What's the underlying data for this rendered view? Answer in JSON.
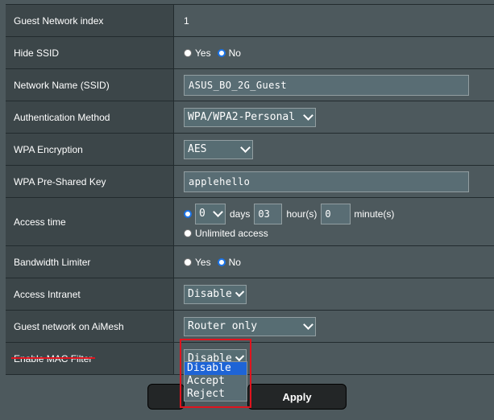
{
  "rows": {
    "guest_index": {
      "label": "Guest Network index",
      "value": "1"
    },
    "hide_ssid": {
      "label": "Hide SSID",
      "yes": "Yes",
      "no": "No"
    },
    "ssid": {
      "label": "Network Name (SSID)",
      "value": "ASUS_BO_2G_Guest"
    },
    "auth": {
      "label": "Authentication Method",
      "value": "WPA/WPA2-Personal"
    },
    "wpa_enc": {
      "label": "WPA Encryption",
      "value": "AES"
    },
    "psk": {
      "label": "WPA Pre-Shared Key",
      "value": "applehello"
    },
    "access_time": {
      "label": "Access time",
      "days_value": "0",
      "days_unit": "days",
      "hours_value": "03",
      "hours_unit": "hour(s)",
      "minutes_value": "0",
      "minutes_unit": "minute(s)",
      "unlimited": "Unlimited access"
    },
    "bandwidth": {
      "label": "Bandwidth Limiter",
      "yes": "Yes",
      "no": "No"
    },
    "intranet": {
      "label": "Access Intranet",
      "value": "Disable"
    },
    "aimesh": {
      "label": "Guest network on AiMesh",
      "value": "Router only"
    },
    "mac_filter": {
      "label": "Enable MAC Filter",
      "value": "Disable",
      "options": [
        "Disable",
        "Accept",
        "Reject"
      ]
    }
  },
  "buttons": {
    "apply": "Apply"
  },
  "colors": {
    "highlight": "#e0141e",
    "selected_option": "#1e64d6"
  }
}
